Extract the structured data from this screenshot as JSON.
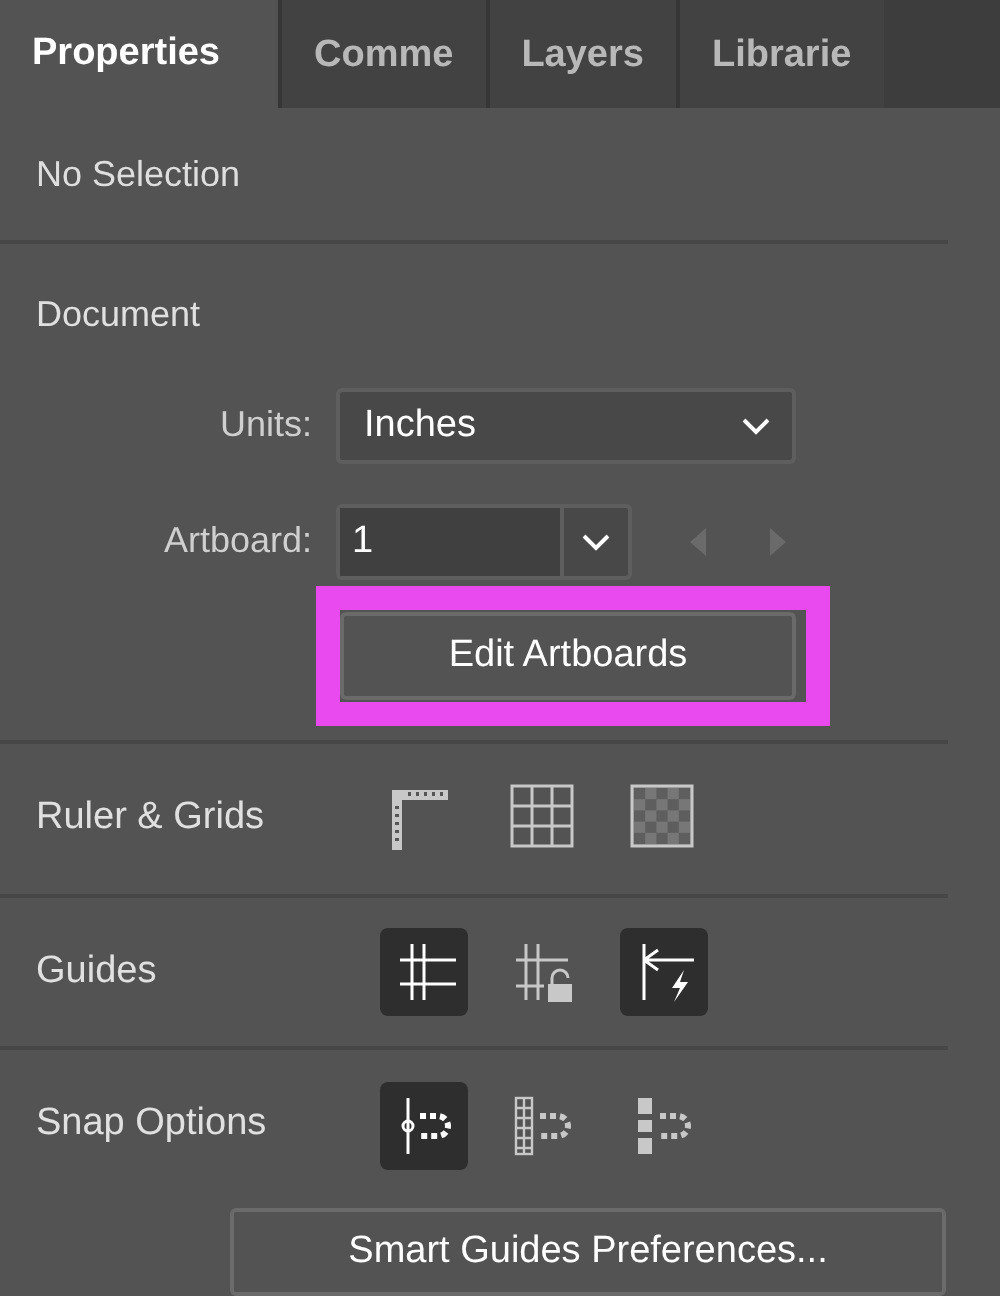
{
  "tabs": [
    {
      "label": "Properties",
      "selected": true
    },
    {
      "label": "Comme",
      "selected": false
    },
    {
      "label": "Layers",
      "selected": false
    },
    {
      "label": "Librarie",
      "selected": false
    }
  ],
  "selection_status": "No Selection",
  "document": {
    "title": "Document",
    "units_label": "Units:",
    "units_value": "Inches",
    "artboard_label": "Artboard:",
    "artboard_value": "1",
    "edit_button": "Edit Artboards",
    "edit_button_highlighted": true
  },
  "toggle_rows": [
    {
      "label": "Ruler & Grids",
      "toggles": [
        {
          "kind": "ruler",
          "on": false
        },
        {
          "kind": "grid",
          "on": false
        },
        {
          "kind": "transparency",
          "on": false
        }
      ]
    },
    {
      "label": "Guides",
      "toggles": [
        {
          "kind": "guides",
          "on": true
        },
        {
          "kind": "lock-guides",
          "on": false
        },
        {
          "kind": "smart-guides",
          "on": true
        }
      ]
    },
    {
      "label": "Snap Options",
      "toggles": [
        {
          "kind": "snap-point",
          "on": true
        },
        {
          "kind": "snap-pixel",
          "on": false
        },
        {
          "kind": "snap-glyph",
          "on": false
        }
      ]
    }
  ],
  "smart_guides_button": "Smart Guides Preferences..."
}
